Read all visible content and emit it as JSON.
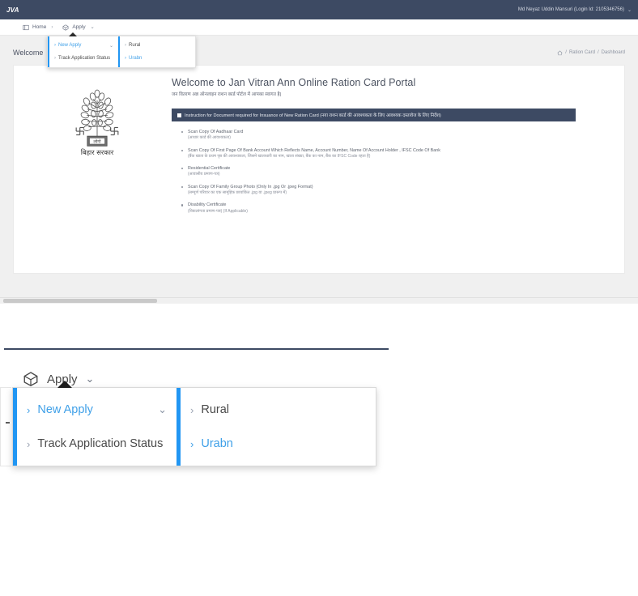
{
  "topbar": {
    "brand": "JVA",
    "user_label": "Md Neyaz Uddin Mansuri (Login Id: 2105346756)",
    "user_caret": "⌄"
  },
  "navstrip": {
    "items": [
      {
        "label": "Home",
        "icon": "window-icon",
        "separator": "›"
      },
      {
        "label": "Apply",
        "icon": "cube-icon",
        "caret": "⌄"
      }
    ]
  },
  "dropdown": {
    "left_column": [
      {
        "label": "New Apply",
        "chevron_right": "›",
        "chevron_down": "⌄",
        "active": true
      },
      {
        "label": "Track Application Status",
        "chevron_right": "›",
        "active": false
      }
    ],
    "right_column": [
      {
        "label": "Rural",
        "chevron_right": "›",
        "active": false
      },
      {
        "label": "Urabn",
        "chevron_right": "›",
        "active": true
      }
    ]
  },
  "page": {
    "welcome_label": "Welcome",
    "breadcrumb": {
      "home_icon": "home-icon",
      "sep1": "/",
      "item1": "Ration Card",
      "sep2": "/",
      "item2": "Dashboard"
    }
  },
  "emblem": {
    "caption": "बिहार  सरकार",
    "plate_text": "लोगो"
  },
  "content": {
    "heading": "Welcome to Jan Vitran Ann Online Ration Card Portal",
    "subheading": "जन वितरण अन्न ऑनलाइन राशन कार्ड पोर्टल में आपका स्वागत है|",
    "instruction_bar": "Instruction for Document required for Insuance of New Ration Card (नया राशन कार्ड की आवश्यकता के लिए आवश्यक दस्तावेज के लिए निर्देश)",
    "documents": [
      {
        "en": "Scan Copy Of Aadhaar Card",
        "hi": "(आधार कार्ड की आवश्यकता)"
      },
      {
        "en": "Scan Copy Of First Page Of Bank Account Which Reflects Name, Account Number, Name Of Account Holder , IFSC Code Of Bank",
        "hi": "(बैंक खाता के प्रथम पृष्ठ की आवश्यकता, जिसमे खाताधारी का नाम, खाता संख्या, बैंक का नाम, बैंक का IFSC Code रहता है)"
      },
      {
        "en": "Residential Certificate",
        "hi": "(आवासीय प्रमाण-पत्र)"
      },
      {
        "en": "Scan Copy Of Family Group Photo (Only In .jpg Or .jpeg Format)",
        "hi": "(सम्पूर्ण परिवार का एक सामूहिक छायांकित .jpg या .jpeg प्रारूप में)"
      },
      {
        "en": "Disability Certificate",
        "hi": "(विकलांगता प्रमाण-पत्र) (If Applicable)"
      }
    ]
  },
  "callout": {
    "apply_label": "Apply",
    "apply_caret": "⌄",
    "cube_icon": "cube-icon",
    "left_column": [
      {
        "label": "New Apply",
        "chevron_right": "›",
        "chevron_down": "⌄",
        "active": true
      },
      {
        "label": "Track Application Status",
        "chevron_right": "›",
        "active": false
      }
    ],
    "right_column": [
      {
        "label": "Rural",
        "chevron_right": "›",
        "active": false
      },
      {
        "label": "Urabn",
        "chevron_right": "›",
        "active": true
      }
    ]
  },
  "theme": {
    "navy": "#3d4a63",
    "accent_blue": "#2196f3",
    "link_blue": "#3fa0e8",
    "page_bg": "#f0f0f0"
  }
}
